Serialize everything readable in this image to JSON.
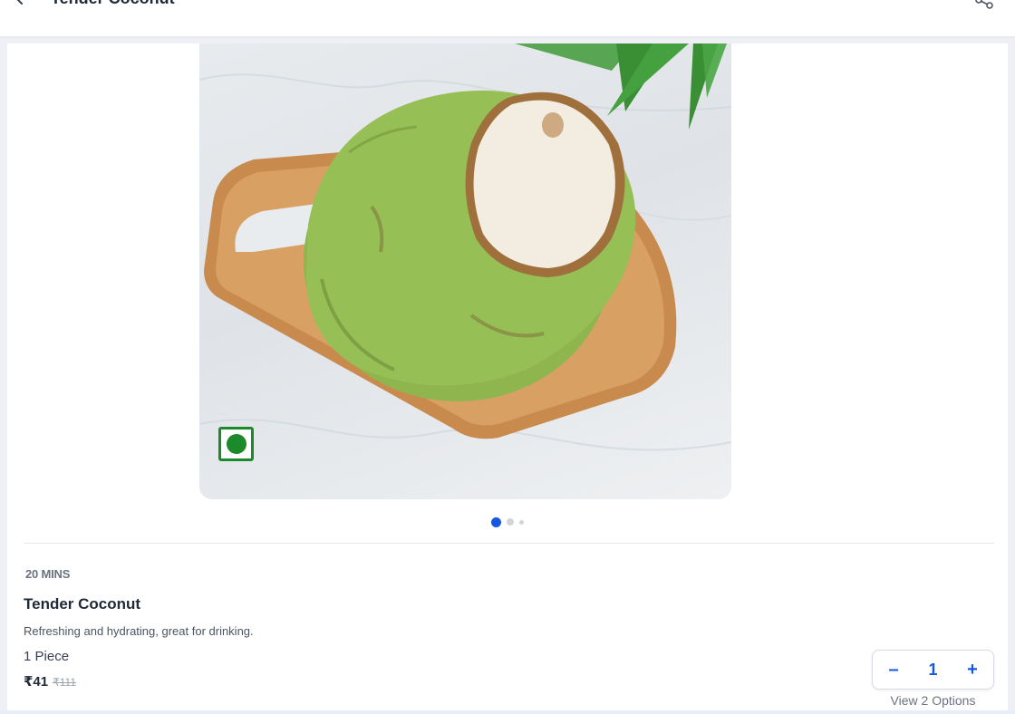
{
  "header": {
    "title": "Tender Coconut",
    "back_icon": "back-arrow-icon",
    "share_icon": "share-icon"
  },
  "product": {
    "image_alt": "coconut-on-cutting-board",
    "veg_indicator": "veg-indicator-icon",
    "carousel": {
      "total": 3,
      "active_index": 0
    },
    "delivery_time": "20 MINS",
    "name": "Tender Coconut",
    "description": "Refreshing and hydrating, great for drinking.",
    "unit": "1 Piece",
    "price": "₹41",
    "mrp": "₹111"
  },
  "cart": {
    "decrement_label": "–",
    "quantity": "1",
    "increment_label": "+",
    "view_options_label": "View 2 Options"
  },
  "colors": {
    "accent": "#1557e0",
    "veg_green": "#1b8a2a"
  }
}
